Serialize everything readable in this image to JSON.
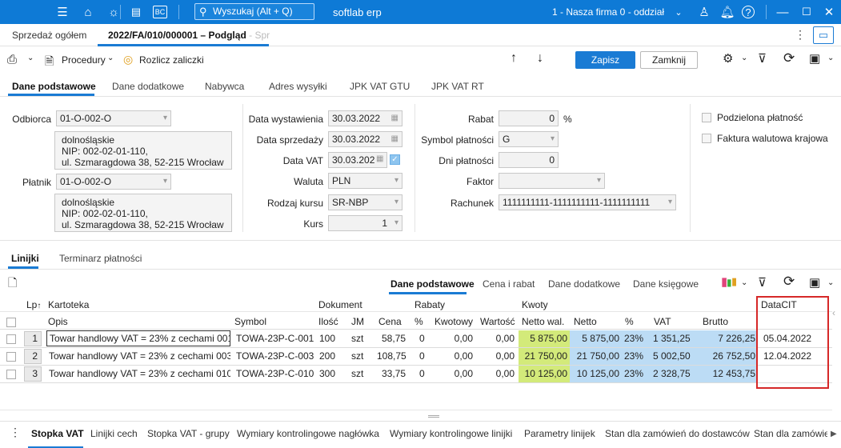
{
  "titlebar": {
    "search_placeholder": "Wyszukaj (Alt + Q)",
    "app_title": "softlab erp",
    "company": "1 - Nasza firma 0 - oddział"
  },
  "doc_tabs": {
    "tab1": "Sprzedaż ogółem",
    "tab2": "2022/FA/010/000001 – Podgląd",
    "tab2_fade": " - Spr"
  },
  "toolbar": {
    "procedury": "Procedury",
    "rozlicz": "Rozlicz zaliczki",
    "save": "Zapisz",
    "close": "Zamknij"
  },
  "section_tabs": [
    "Dane podstawowe",
    "Dane dodatkowe",
    "Nabywca",
    "Adres wysyłki",
    "JPK VAT GTU",
    "JPK VAT RT"
  ],
  "form": {
    "odbiorca_label": "Odbiorca",
    "odbiorca_value": "01-O-002-O",
    "odbiorca_addr": [
      "dolnośląskie",
      "NIP: 002-02-01-110,",
      "ul. Szmaragdowa 38, 52-215 Wrocław"
    ],
    "platnik_label": "Płatnik",
    "platnik_value": "01-O-002-O",
    "platnik_addr": [
      "dolnośląskie",
      "NIP: 002-02-01-110,",
      "ul. Szmaragdowa 38, 52-215 Wrocław"
    ],
    "data_wyst_label": "Data wystawienia",
    "data_wyst": "30.03.2022",
    "data_sprz_label": "Data sprzedaży",
    "data_sprz": "30.03.2022",
    "data_vat_label": "Data VAT",
    "data_vat": "30.03.202",
    "waluta_label": "Waluta",
    "waluta": "PLN",
    "rodzaj_kursu_label": "Rodzaj kursu",
    "rodzaj_kursu": "SR-NBP",
    "kurs_label": "Kurs",
    "kurs": "1",
    "rabat_label": "Rabat",
    "rabat": "0",
    "rabat_unit": "%",
    "symbol_label": "Symbol płatności",
    "symbol": "G",
    "dni_label": "Dni płatności",
    "dni": "0",
    "faktor_label": "Faktor",
    "faktor": "",
    "rachunek_label": "Rachunek",
    "rachunek": "1111111111-1111111111-1111111111",
    "podzielona": "Podzielona płatność",
    "faktura_walutowa": "Faktura walutowa krajowa"
  },
  "lines_tabs": [
    "Linijki",
    "Terminarz płatności"
  ],
  "lines_subtabs": [
    "Dane podstawowe",
    "Cena i rabat",
    "Dane dodatkowe",
    "Dane księgowe"
  ],
  "grid": {
    "group_headers": {
      "lp": "Lp",
      "kartoteka": "Kartoteka",
      "dokument": "Dokument",
      "rabaty": "Rabaty",
      "kwoty": "Kwoty",
      "datacit": "DataCIT"
    },
    "col_headers": {
      "opis": "Opis",
      "symbol": "Symbol",
      "ilosc": "Ilość",
      "jm": "JM",
      "cena": "Cena",
      "pct": "%",
      "kwotowy": "Kwotowy",
      "wartosc": "Wartość",
      "netto_wal": "Netto wal.",
      "netto": "Netto",
      "vat_pct": "%",
      "vat": "VAT",
      "brutto": "Brutto"
    },
    "rows": [
      {
        "lp": "1",
        "opis": "Towar handlowy VAT = 23% z cechami 001",
        "symbol": "TOWA-23P-C-001",
        "ilosc": "100",
        "jm": "szt",
        "cena": "58,75",
        "pct": "0",
        "kwotowy": "0,00",
        "wartosc": "0,00",
        "netto_wal": "5 875,00",
        "netto": "5 875,00",
        "vat_pct": "23%",
        "vat": "1 351,25",
        "brutto": "7 226,25",
        "datacit": "05.04.2022"
      },
      {
        "lp": "2",
        "opis": "Towar handlowy VAT = 23% z cechami 003",
        "symbol": "TOWA-23P-C-003",
        "ilosc": "200",
        "jm": "szt",
        "cena": "108,75",
        "pct": "0",
        "kwotowy": "0,00",
        "wartosc": "0,00",
        "netto_wal": "21 750,00",
        "netto": "21 750,00",
        "vat_pct": "23%",
        "vat": "5 002,50",
        "brutto": "26 752,50",
        "datacit": "12.04.2022"
      },
      {
        "lp": "3",
        "opis": "Towar handlowy VAT = 23% z cechami 010",
        "symbol": "TOWA-23P-C-010",
        "ilosc": "300",
        "jm": "szt",
        "cena": "33,75",
        "pct": "0",
        "kwotowy": "0,00",
        "wartosc": "0,00",
        "netto_wal": "10 125,00",
        "netto": "10 125,00",
        "vat_pct": "23%",
        "vat": "2 328,75",
        "brutto": "12 453,75",
        "datacit": ""
      }
    ]
  },
  "bottom_tabs": [
    "Stopka VAT",
    "Linijki cech",
    "Stopka VAT - grupy",
    "Wymiary kontrolingowe nagłówka",
    "Wymiary kontrolingowe linijki",
    "Parametry linijek",
    "Stan dla zamówień do dostawców",
    "Stan dla zamówie"
  ]
}
